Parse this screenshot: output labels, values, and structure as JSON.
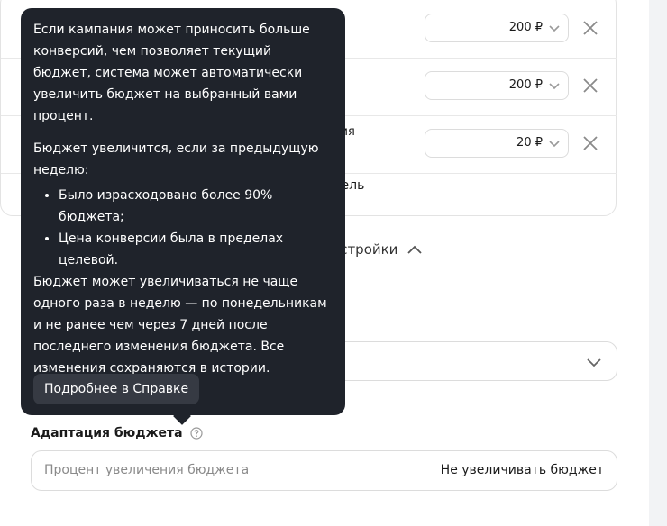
{
  "goals": {
    "rows": [
      {
        "fragment": "",
        "price": "200 ₽"
      },
      {
        "fragment": "",
        "price": "200 ₽"
      },
      {
        "fragment": "ния",
        "price": "20 ₽"
      }
    ],
    "add_goal_fragment": "цель"
  },
  "settings_toggle_fragment": "астройки",
  "budget": {
    "label": "Адаптация бюджета",
    "placeholder": "Процент увеличения бюджета",
    "value": "Не увеличивать бюджет"
  },
  "tooltip": {
    "paragraph1": "Если кампания может приносить больше конверсий, чем позволяет текущий бюджет, система может автоматически увеличить бюджет на выбранный вами процент.",
    "paragraph2": "Бюджет увеличится, если за предыдущую неделю:",
    "bullets": [
      "Было израсходовано более 90% бюджета;",
      "Цена конверсии была в пределах целевой."
    ],
    "paragraph3": "Бюджет может увеличиваться не чаще одного раза в неделю — по понедельникам и не ранее чем через 7 дней после последнего изменения бюджета. Все изменения сохраняются в истории.",
    "help_button": "Подробнее в Справке"
  },
  "icons": {
    "chevron": "chevron-down-icon",
    "close": "close-icon",
    "help": "question-circle-icon",
    "collapse": "chevron-up-icon"
  }
}
